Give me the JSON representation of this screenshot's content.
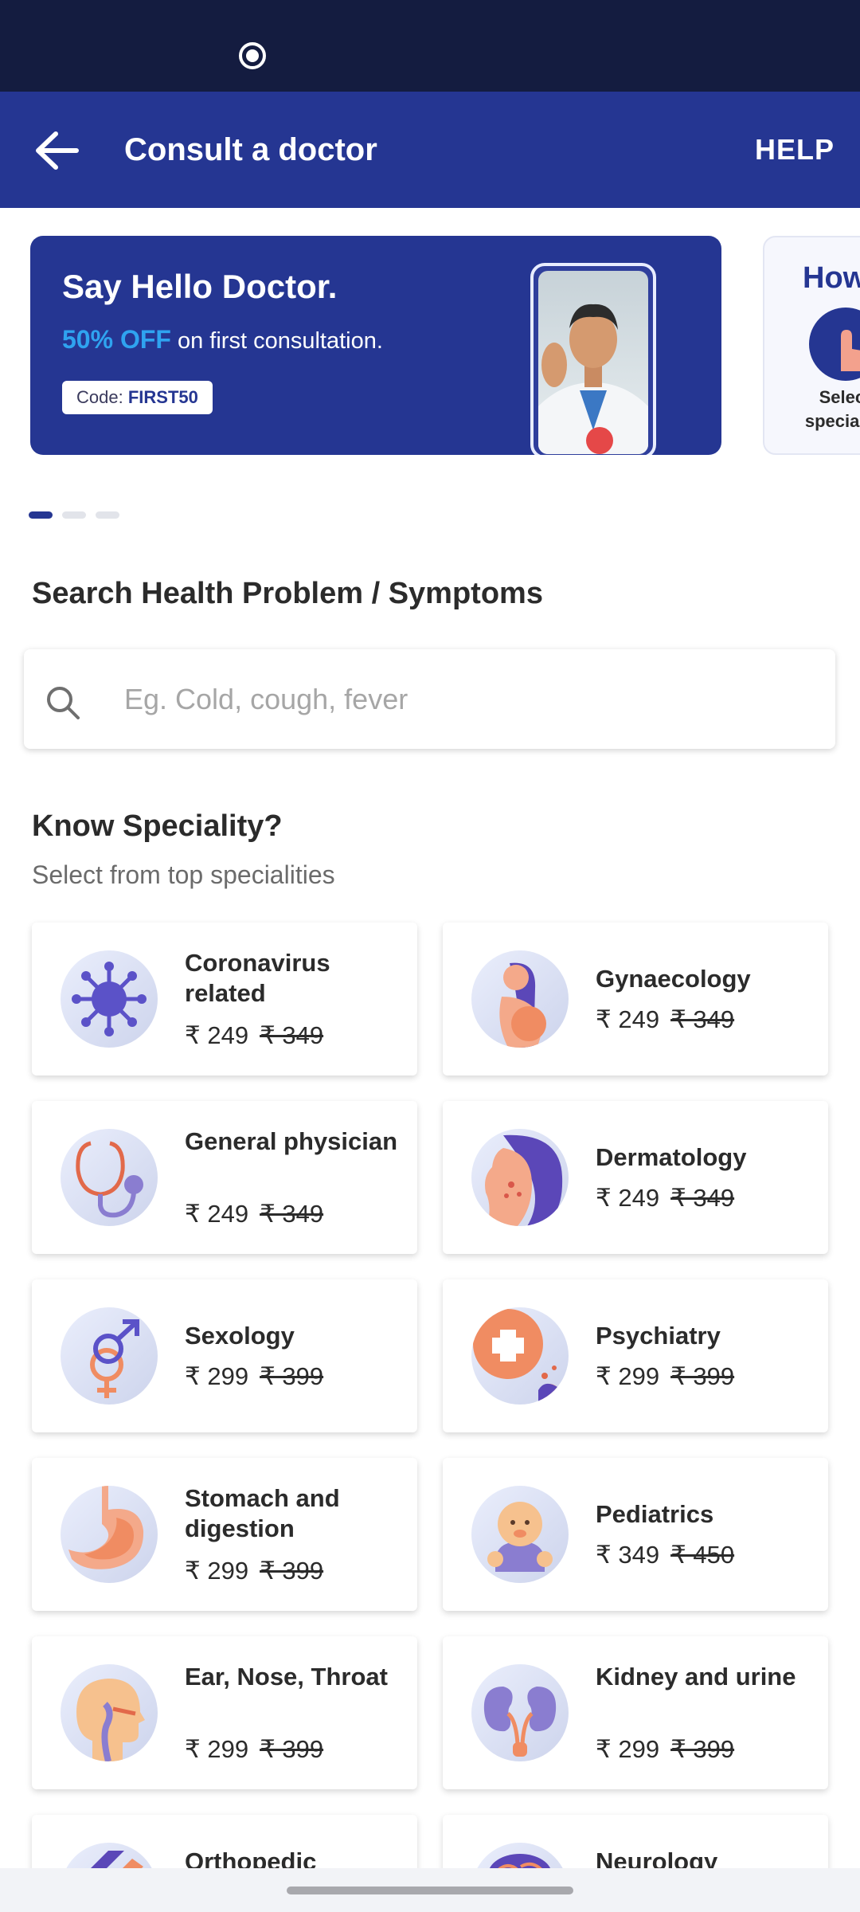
{
  "header": {
    "title": "Consult a doctor",
    "help_label": "HELP"
  },
  "banner": {
    "title": "Say Hello Doctor.",
    "discount": "50% OFF",
    "subtitle_rest": " on first consultation.",
    "code_label": "Code: ",
    "code_value": "FIRST50"
  },
  "banner2": {
    "title": "How",
    "text": "Select speciality"
  },
  "search": {
    "title": "Search Health Problem / Symptoms",
    "placeholder": "Eg. Cold, cough, fever"
  },
  "specialities": {
    "title": "Know Speciality?",
    "subtitle": "Select from top specialities",
    "items": [
      {
        "name": "Coronavirus related",
        "price": "₹ 249",
        "old_price": "₹ 349",
        "icon": "virus-icon"
      },
      {
        "name": "Gynaecology",
        "price": "₹ 249",
        "old_price": "₹ 349",
        "icon": "pregnant-woman-icon"
      },
      {
        "name": "General physician",
        "price": "₹ 249",
        "old_price": "₹ 349",
        "icon": "stethoscope-icon"
      },
      {
        "name": "Dermatology",
        "price": "₹ 249",
        "old_price": "₹ 349",
        "icon": "skin-face-icon"
      },
      {
        "name": "Sexology",
        "price": "₹ 299",
        "old_price": "₹ 399",
        "icon": "gender-symbols-icon"
      },
      {
        "name": "Psychiatry",
        "price": "₹ 299",
        "old_price": "₹ 399",
        "icon": "mind-icon"
      },
      {
        "name": "Stomach and digestion",
        "price": "₹ 299",
        "old_price": "₹ 399",
        "icon": "stomach-icon"
      },
      {
        "name": "Pediatrics",
        "price": "₹ 349",
        "old_price": "₹ 450",
        "icon": "baby-icon"
      },
      {
        "name": "Ear, Nose, Throat",
        "price": "₹ 299",
        "old_price": "₹ 399",
        "icon": "ent-head-icon"
      },
      {
        "name": "Kidney and urine",
        "price": "₹ 299",
        "old_price": "₹ 399",
        "icon": "kidney-icon"
      },
      {
        "name": "Orthopedic",
        "icon": "bone-icon"
      },
      {
        "name": "Neurology",
        "icon": "brain-icon"
      }
    ]
  }
}
